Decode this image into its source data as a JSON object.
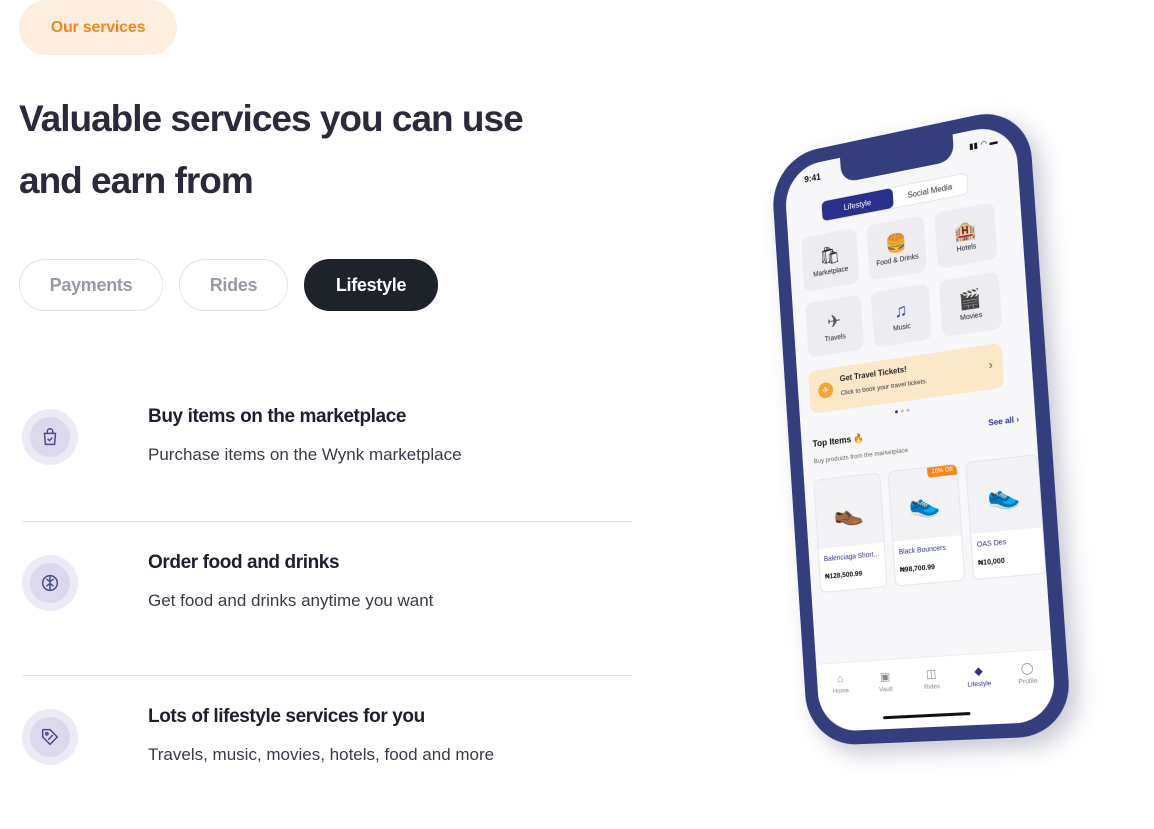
{
  "section_label": "Our services",
  "headline": {
    "line1": "Valuable services you can use",
    "line2": "and earn from"
  },
  "tabs": [
    {
      "label": "Payments",
      "active": false
    },
    {
      "label": "Rides",
      "active": false
    },
    {
      "label": "Lifestyle",
      "active": true
    }
  ],
  "features": [
    {
      "icon": "shopping-bag-icon",
      "title": "Buy items on the marketplace",
      "description": "Purchase items on the Wynk marketplace"
    },
    {
      "icon": "brain-icon",
      "title": "Order food and drinks",
      "description": "Get food and drinks anytime you want"
    },
    {
      "icon": "tag-icon",
      "title": "Lots of lifestyle services for you",
      "description": "Travels, music, movies, hotels, food and more"
    }
  ],
  "phone": {
    "time": "9:41",
    "segments": [
      "Lifestyle",
      "Social Media"
    ],
    "grid": [
      {
        "label": "Marketplace",
        "glyph": "🛍"
      },
      {
        "label": "Food & Drinks",
        "glyph": "🍔"
      },
      {
        "label": "Hotels",
        "glyph": "🏨"
      },
      {
        "label": "Travels",
        "glyph": "✈"
      },
      {
        "label": "Music",
        "glyph": "♫"
      },
      {
        "label": "Movies",
        "glyph": "🎬"
      }
    ],
    "banner": {
      "title": "Get Travel Tickets!",
      "subtitle": "Click to book your travel tickets."
    },
    "top_items": {
      "title": "Top Items 🔥",
      "see_all": "See all ›",
      "subtitle": "Buy products from the marketplace"
    },
    "products": [
      {
        "name": "Balenciaga Short...",
        "price": "₦128,500.99",
        "badge": ""
      },
      {
        "name": "Black Bouncers",
        "price": "₦98,700.99",
        "badge": "10% Off"
      },
      {
        "name": "OAS Des",
        "price": "₦10,000",
        "badge": ""
      }
    ],
    "nav": [
      {
        "label": "Home",
        "active": false
      },
      {
        "label": "Vault",
        "active": false
      },
      {
        "label": "Rides",
        "active": false
      },
      {
        "label": "Lifestyle",
        "active": true
      },
      {
        "label": "Profile",
        "active": false
      }
    ]
  },
  "colors": {
    "accent_orange": "#f2871c",
    "brand_navy": "#353e7c",
    "dark_button": "#1e2229"
  }
}
